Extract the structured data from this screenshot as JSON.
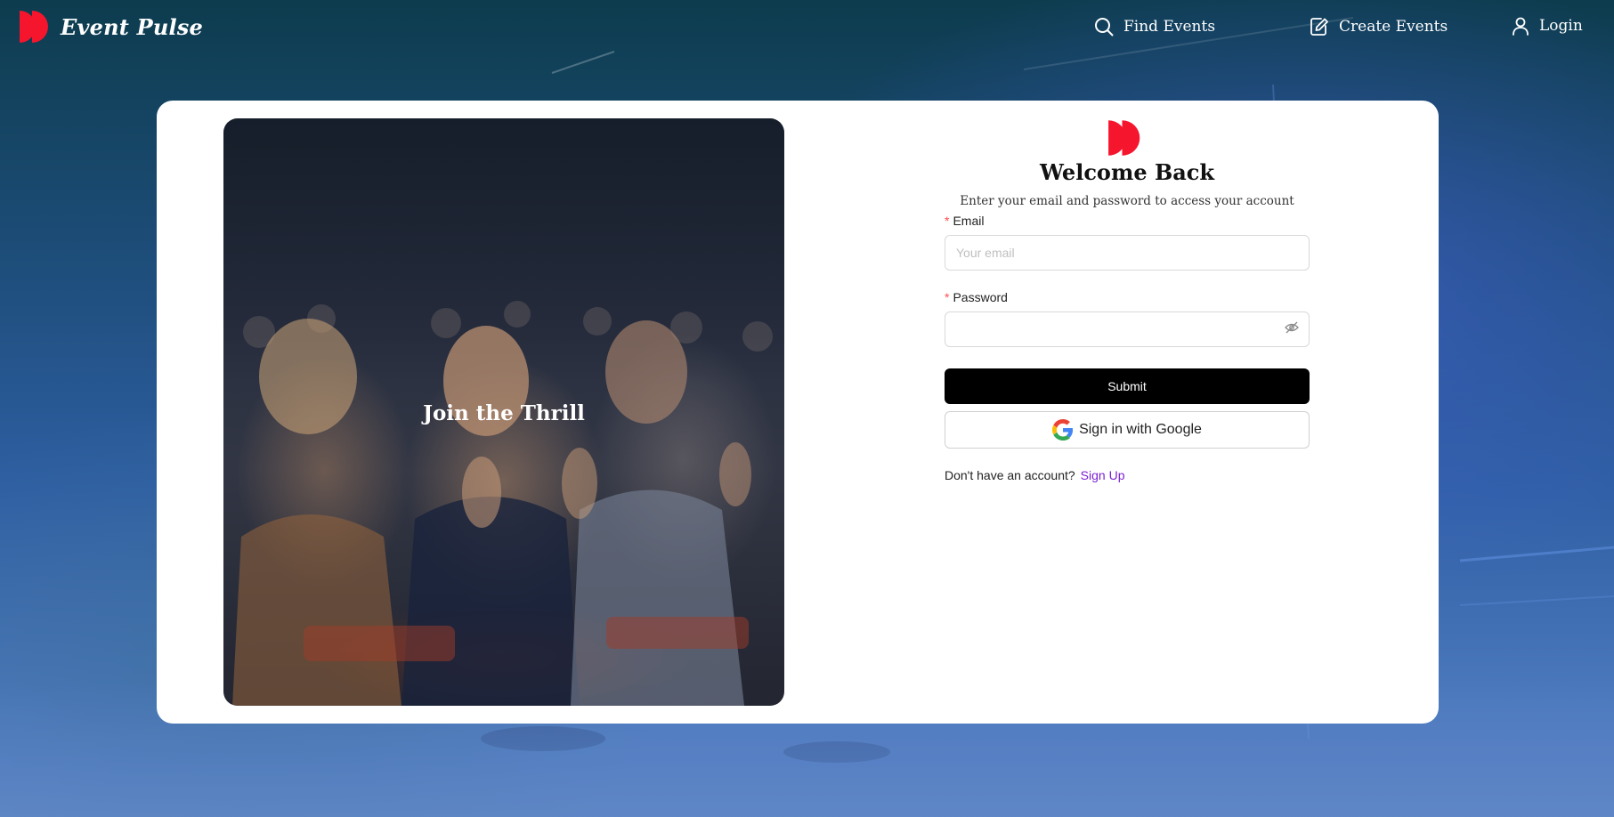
{
  "header": {
    "brand": "Event Pulse",
    "nav": [
      {
        "label": "Find Events",
        "icon": "search-icon"
      },
      {
        "label": "Create Events",
        "icon": "edit-icon"
      },
      {
        "label": "Login",
        "icon": "user-icon"
      }
    ]
  },
  "hero": {
    "title": "Join the Thrill"
  },
  "login": {
    "title": "Welcome Back",
    "subtitle": "Enter your email and password to access your account",
    "email_label": "Email",
    "email_placeholder": "Your email",
    "email_value": "",
    "password_label": "Password",
    "password_value": "",
    "required_mark": "*",
    "submit_label": "Submit",
    "google_label": "Sign in with Google",
    "no_account_text": "Don't have an account?",
    "signup_label": "Sign Up"
  },
  "colors": {
    "brand_red": "#f5152d",
    "link_purple": "#7b1fd3",
    "button_black": "#000000"
  }
}
